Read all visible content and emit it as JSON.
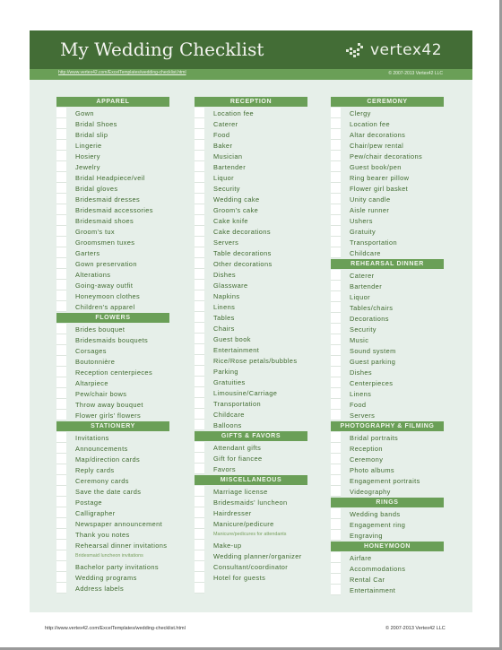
{
  "header": {
    "title": "My Wedding Checklist",
    "logo_text": "vertex42",
    "logo_icon": "vertex42-logo-icon",
    "url": "http://www.vertex42.com/ExcelTemplates/wedding-checklist.html",
    "copyright": "© 2007-2013 Vertex42 LLC"
  },
  "colors": {
    "header_dark": "#436d36",
    "accent_green": "#6a9f57",
    "sheet_bg": "#e6efe9",
    "item_text": "#3f6a2f"
  },
  "columns": [
    {
      "sections": [
        {
          "title": "APPAREL",
          "items": [
            "Gown",
            "Bridal Shoes",
            "Bridal slip",
            "Lingerie",
            "Hosiery",
            "Jewelry",
            "Bridal Headpiece/veil",
            "Bridal gloves",
            "Bridesmaid dresses",
            "Bridesmaid accessories",
            "Bridesmaid shoes",
            "Groom's tux",
            "Groomsmen tuxes",
            "Garters",
            "Gown preservation",
            "Alterations",
            "Going-away outfit",
            "Honeymoon clothes",
            "Children's apparel"
          ]
        },
        {
          "title": "FLOWERS",
          "items": [
            "Brides bouquet",
            "Bridesmaids bouquets",
            "Corsages",
            "Boutonnière",
            "Reception centerpieces",
            "Altarpiece",
            "Pew/chair bows",
            "Throw away bouquet",
            "Flower girls' flowers"
          ]
        },
        {
          "title": "STATIONERY",
          "items": [
            "Invitations",
            "Announcements",
            "Map/direction cards",
            "Reply cards",
            "Ceremony cards",
            "Save the date cards",
            "Postage",
            "Calligrapher",
            "Newspaper announcement",
            "Thank you notes",
            "Rehearsal dinner invitations",
            "Bridesmaid luncheon invitations",
            "Bachelor party invitations",
            "Wedding programs",
            "Address labels"
          ]
        }
      ]
    },
    {
      "sections": [
        {
          "title": "RECEPTION",
          "items": [
            "Location fee",
            "Caterer",
            "Food",
            "Baker",
            "Musician",
            "Bartender",
            "Liquor",
            "Security",
            "Wedding cake",
            "Groom's cake",
            "Cake knife",
            "Cake decorations",
            "Servers",
            "Table decorations",
            "Other decorations",
            "Dishes",
            "Glassware",
            "Napkins",
            "Linens",
            "Tables",
            "Chairs",
            "Guest book",
            "Entertainment",
            "Rice/Rose petals/bubbles",
            "Parking",
            "Gratuities",
            "Limousine/Carriage",
            "Transportation",
            "Childcare",
            "Balloons"
          ]
        },
        {
          "title": "GIFTS & FAVORS",
          "items": [
            "Attendant gifts",
            "Gift for fiancee",
            "Favors"
          ]
        },
        {
          "title": "MISCELLANEOUS",
          "items": [
            "Marriage license",
            "Bridesmaids' luncheon",
            "Hairdresser",
            "Manicure/pedicure",
            "Manicure/pedicures for attendants",
            "Make-up",
            "Wedding planner/organizer",
            "Consultant/coordinator",
            "Hotel for guests",
            ""
          ]
        }
      ]
    },
    {
      "sections": [
        {
          "title": "CEREMONY",
          "items": [
            "Clergy",
            "Location fee",
            "Altar decorations",
            "Chair/pew rental",
            "Pew/chair decorations",
            "Guest book/pen",
            "Ring bearer pillow",
            "Flower girl basket",
            "Unity candle",
            "Aisle runner",
            "Ushers",
            "Gratuity",
            "Transportation",
            "Childcare"
          ]
        },
        {
          "title": "REHEARSAL DINNER",
          "items": [
            "Caterer",
            "Bartender",
            "Liquor",
            "Tables/chairs",
            "Decorations",
            "Security",
            "Music",
            "Sound system",
            "Guest parking",
            "Dishes",
            "Centerpieces",
            "Linens",
            "Food",
            "Servers"
          ]
        },
        {
          "title": "PHOTOGRAPHY & FILMING",
          "items": [
            "Bridal portraits",
            "Reception",
            "Ceremony",
            "Photo albums",
            "Engagement portraits",
            "Videography"
          ]
        },
        {
          "title": "RINGS",
          "items": [
            "Wedding bands",
            "Engagement ring",
            "Engraving"
          ]
        },
        {
          "title": "HONEYMOON",
          "items": [
            "Airfare",
            "Accommodations",
            "Rental Car",
            "Entertainment"
          ]
        }
      ]
    }
  ],
  "footer": {
    "url": "http://www.vertex42.com/ExcelTemplates/wedding-checklist.html",
    "copyright": "© 2007-2013 Vertex42 LLC"
  }
}
